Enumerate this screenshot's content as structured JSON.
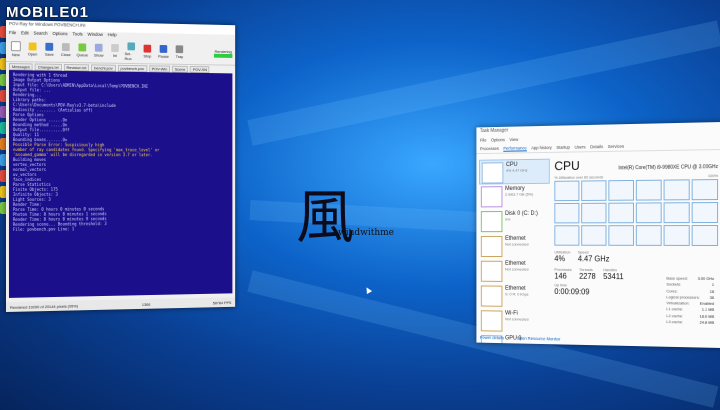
{
  "watermark": "MOBILE01",
  "povray": {
    "title": "POV-Ray for Windows POVBENCH.INI",
    "menu": [
      "File",
      "Edit",
      "Search",
      "Options",
      "Tools",
      "Window",
      "Help"
    ],
    "toolbar": [
      "New",
      "Open",
      "Save",
      "Close",
      "Queue",
      "Show",
      "Ini",
      "Sel-Run",
      "Stop",
      "Pause",
      "Tray"
    ],
    "render_status": "Rendering",
    "tabs": [
      "Messages",
      "Changes.txt",
      "Revision.txt",
      "benchl.pov",
      "povbench.pov",
      "POV-Win",
      "Scene",
      "POV-SN"
    ],
    "console_lines": [
      "Rendering with 1 thread",
      "Image Output Options",
      "  Input file: C:\\Users\\ADMIN\\AppData\\Local\\Temp\\POVBENCH.INI",
      "  Output file: ...",
      "Rendering...",
      "Library paths:",
      "  C:\\Users\\Documents\\POV-Ray\\v3.7-beta\\include",
      "Radiosity ........ (Antialias off)",
      "Parse Options",
      "  Render Options ......On",
      "  Bounding method .....On",
      "  Output file..........Off",
      "  Quality: 11",
      "  Bounding boxes.......On"
    ],
    "warn_lines": [
      "Possible Parse Error: Suspiciously high",
      "number of ray candidates found. Specifying 'max_trace_level' or",
      "'assumed_gamma' will be disregarded in version 3.7 or later."
    ],
    "console_lines_2": [
      "Building moves",
      "  vertex_vectors",
      "  normal_vectors",
      "  uv_vectors",
      "  face_indices",
      "Parse Statistics",
      "  Finite Objects: 175",
      "  Infinite Objects: 3",
      "  Light Sources: 3",
      "Render Time:",
      "  Parse Time: 0 hours 0 minutes 0 seconds",
      "  Photon Time: 0 hours 0 minutes 1 seconds",
      "  Render Time: 0 hours 0 minutes 9 seconds",
      "Rendering scene... Bounding threshold: 3",
      "  File: povbench.pov  Line: 1"
    ],
    "status_left": "Rendered 19200 of 20144 pixels (95%)",
    "status_mid": "1366",
    "status_right": "58784 PPS"
  },
  "logo": {
    "glyph": "風",
    "text": "windwithme"
  },
  "taskmanager": {
    "title": "Task Manager",
    "menu": [
      "File",
      "Options",
      "View"
    ],
    "tabs": [
      "Processes",
      "Performance",
      "App history",
      "Startup",
      "Users",
      "Details",
      "Services"
    ],
    "active_tab": "Performance",
    "side_items": [
      {
        "name": "CPU",
        "sub": "4% 4.47 GHz",
        "kind": "cpu"
      },
      {
        "name": "Memory",
        "sub": "2.9/63.7 GB (5%)",
        "kind": "mem"
      },
      {
        "name": "Disk 0 (C: D:)",
        "sub": "0%",
        "kind": "disk"
      },
      {
        "name": "Ethernet",
        "sub": "Not connected",
        "kind": "eth"
      },
      {
        "name": "Ethernet",
        "sub": "Not connected",
        "kind": "eth"
      },
      {
        "name": "Ethernet",
        "sub": "S: 0 R: 0 Kbps",
        "kind": "eth"
      },
      {
        "name": "Wi-Fi",
        "sub": "Not connected",
        "kind": "eth"
      },
      {
        "name": "GPU 0",
        "sub": "",
        "kind": "cpu"
      }
    ],
    "cpu_label": "CPU",
    "cpu_model": "Intel(R) Core(TM) i9-9980XE CPU @ 3.00GHz",
    "graph_caption": "% Utilization over 60 seconds",
    "graph_max": "100%",
    "stats": [
      {
        "label": "Utilization",
        "value": "4%"
      },
      {
        "label": "Speed",
        "value": "4.47 GHz"
      }
    ],
    "stats2": [
      {
        "label": "Processes",
        "value": "146"
      },
      {
        "label": "Threads",
        "value": "2278"
      },
      {
        "label": "Handles",
        "value": "53411"
      }
    ],
    "uptime_label": "Up time",
    "uptime": "0:00:09:09",
    "specs": [
      {
        "k": "Base speed:",
        "v": "3.00 GHz"
      },
      {
        "k": "Sockets:",
        "v": "1"
      },
      {
        "k": "Cores:",
        "v": "18"
      },
      {
        "k": "Logical processors:",
        "v": "36"
      },
      {
        "k": "Virtualization:",
        "v": "Enabled"
      },
      {
        "k": "L1 cache:",
        "v": "1.1 MB"
      },
      {
        "k": "L2 cache:",
        "v": "18.0 MB"
      },
      {
        "k": "L3 cache:",
        "v": "24.8 MB"
      }
    ],
    "fewer_details": "Fewer details",
    "open_monitor": "Open Resource Monitor"
  }
}
